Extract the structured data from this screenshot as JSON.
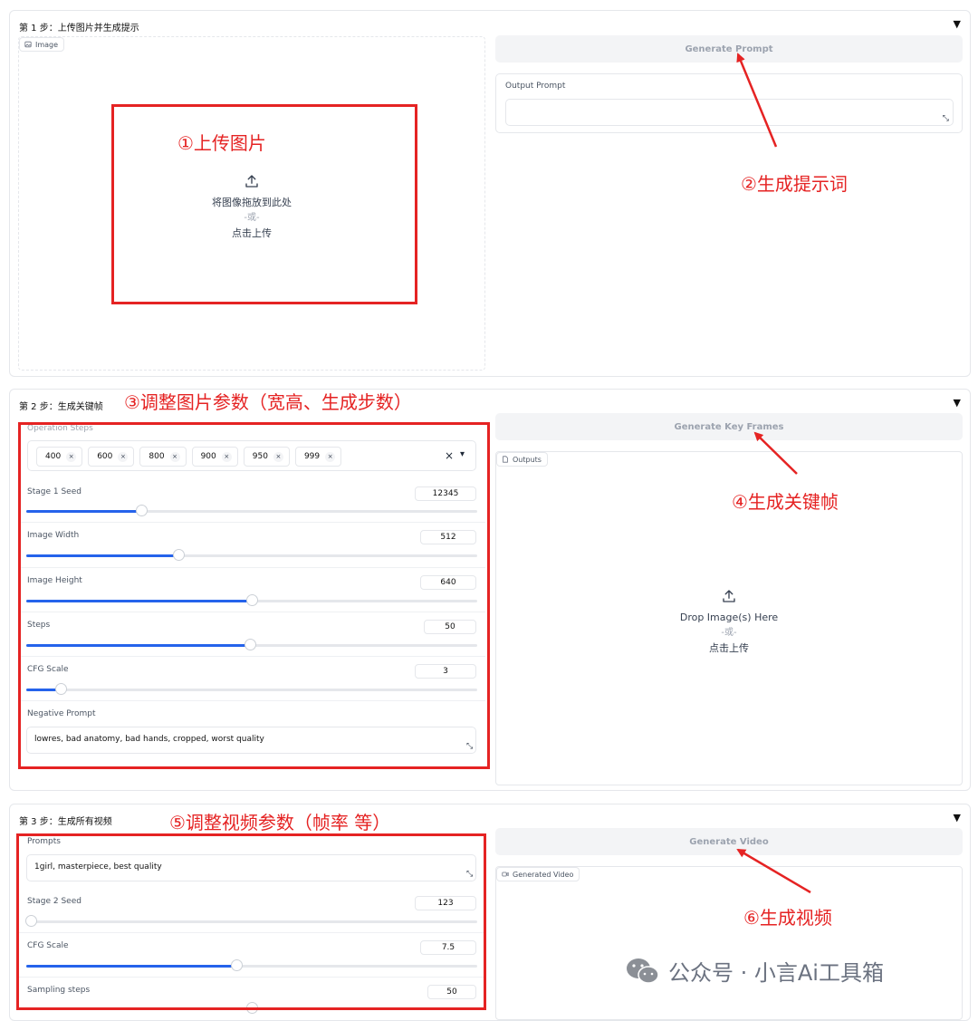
{
  "step1": {
    "title": "第 1 步：上传图片并生成提示",
    "image_label": "Image",
    "upload_text": "将图像拖放到此处",
    "upload_or": "-或-",
    "upload_click": "点击上传",
    "generate_btn": "Generate Prompt",
    "output_label": "Output Prompt",
    "output_value": ""
  },
  "step2": {
    "title": "第 2 步：生成关键帧",
    "operation_steps_label": "Operation Steps",
    "operation_steps": [
      "400",
      "600",
      "800",
      "900",
      "950",
      "999"
    ],
    "sliders": [
      {
        "label": "Stage 1 Seed",
        "value": "12345",
        "fraction": 0.255
      },
      {
        "label": "Image Width",
        "value": "512",
        "fraction": 0.337
      },
      {
        "label": "Image Height",
        "value": "640",
        "fraction": 0.5
      },
      {
        "label": "Steps",
        "value": "50",
        "fraction": 0.495
      },
      {
        "label": "CFG Scale",
        "value": "3",
        "fraction": 0.077
      }
    ],
    "negative_label": "Negative Prompt",
    "negative_value": "lowres, bad anatomy, bad hands, cropped, worst quality",
    "generate_btn": "Generate Key Frames",
    "outputs_label": "Outputs",
    "drop_text": "Drop Image(s) Here",
    "drop_or": "-或-",
    "drop_click": "点击上传"
  },
  "step3": {
    "title": "第 3 步：生成所有视频",
    "prompts_label": "Prompts",
    "prompts_value": "1girl, masterpiece, best quality",
    "sliders": [
      {
        "label": "Stage 2 Seed",
        "value": "123",
        "fraction": 0.01
      },
      {
        "label": "CFG Scale",
        "value": "7.5",
        "fraction": 0.465
      },
      {
        "label": "Sampling steps",
        "value": "50",
        "fraction": 0.5
      }
    ],
    "generate_btn": "Generate Video",
    "video_label": "Generated Video"
  },
  "annotations": {
    "a1": "①上传图片",
    "a2": "②生成提示词",
    "a3": "③调整图片参数（宽高、生成步数）",
    "a4": "④生成关键帧",
    "a5": "⑤调整视频参数（帧率 等）",
    "a6": "⑥生成视频"
  },
  "watermark": "公众号 · 小言Ai工具箱",
  "colors": {
    "annotation": "#e52323",
    "slider": "#2563eb",
    "button_bg": "#f3f4f6"
  },
  "icons": {
    "collapse": "▼",
    "resize": "⤡",
    "clear": "×",
    "dropdown": "▾"
  }
}
